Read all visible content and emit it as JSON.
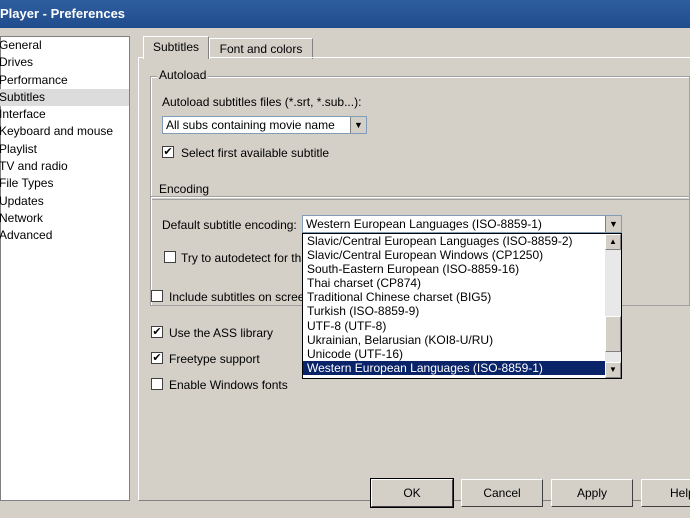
{
  "window": {
    "title": "Player - Preferences"
  },
  "sidebar": {
    "items": [
      {
        "label": "General"
      },
      {
        "label": "Drives"
      },
      {
        "label": "Performance"
      },
      {
        "label": "Subtitles"
      },
      {
        "label": "Interface"
      },
      {
        "label": "Keyboard and mouse"
      },
      {
        "label": "Playlist"
      },
      {
        "label": "TV and radio"
      },
      {
        "label": "File Types"
      },
      {
        "label": "Updates"
      },
      {
        "label": "Network"
      },
      {
        "label": "Advanced"
      }
    ],
    "selected": "Subtitles"
  },
  "tabs": [
    {
      "label": "Subtitles"
    },
    {
      "label": "Font and colors"
    }
  ],
  "autoload": {
    "group_title": "Autoload",
    "files_label": "Autoload subtitles files (*.srt, *.sub...):",
    "files_value": "All subs containing movie name",
    "select_first_label": "Select first available subtitle",
    "select_first_checked": true
  },
  "encoding": {
    "group_title": "Encoding",
    "default_label": "Default subtitle encoding:",
    "default_value": "Western European Languages (ISO-8859-1)",
    "autodetect_label": "Try to autodetect for th",
    "autodetect_checked": false,
    "options": [
      "Slavic/Central European Languages (ISO-8859-2)",
      "Slavic/Central European Windows (CP1250)",
      "South-Eastern European (ISO-8859-16)",
      "Thai charset (CP874)",
      "Traditional Chinese charset (BIG5)",
      "Turkish (ISO-8859-9)",
      "UTF-8 (UTF-8)",
      "Ukrainian, Belarusian (KOI8-U/RU)",
      "Unicode (UTF-16)",
      "Western European Languages (ISO-8859-1)"
    ],
    "selected_option": "Western European Languages (ISO-8859-1)"
  },
  "options": {
    "include_on_screenshots_label": "Include subtitles on scree",
    "include_on_screenshots_checked": false,
    "use_ass_label": "Use the ASS library",
    "use_ass_checked": true,
    "freetype_label": "Freetype support",
    "freetype_checked": true,
    "windows_fonts_label": "Enable Windows fonts",
    "windows_fonts_checked": false
  },
  "buttons": {
    "ok": "OK",
    "cancel": "Cancel",
    "apply": "Apply",
    "help": "Help"
  },
  "colors": {
    "selection": "#0a246a",
    "face": "#d4d0c8"
  }
}
